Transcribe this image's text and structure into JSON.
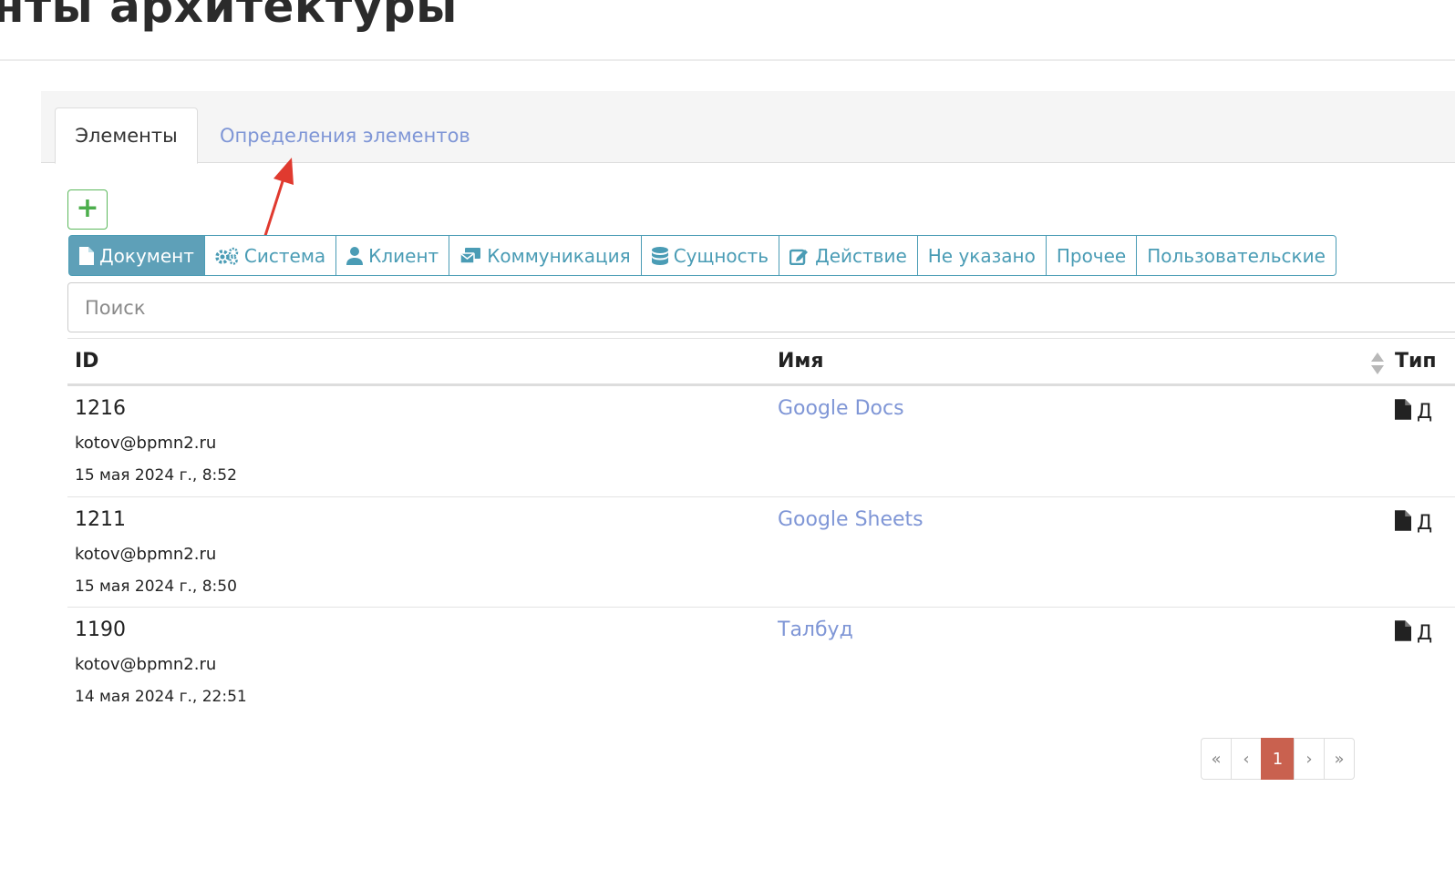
{
  "header": {
    "title": "нты архитектуры"
  },
  "tabs": [
    {
      "label": "Элементы",
      "active": true
    },
    {
      "label": "Определения элементов",
      "active": false
    }
  ],
  "toolbar": {
    "add_icon": "plus-icon"
  },
  "filters": [
    {
      "label": "Документ",
      "icon": "file-icon",
      "active": true
    },
    {
      "label": "Система",
      "icon": "gears-icon",
      "active": false
    },
    {
      "label": "Клиент",
      "icon": "user-icon",
      "active": false
    },
    {
      "label": "Коммуникация",
      "icon": "envelope-icon",
      "active": false
    },
    {
      "label": "Сущность",
      "icon": "database-icon",
      "active": false
    },
    {
      "label": "Действие",
      "icon": "edit-icon",
      "active": false
    },
    {
      "label": "Не указано",
      "icon": "",
      "active": false
    },
    {
      "label": "Прочее",
      "icon": "",
      "active": false
    },
    {
      "label": "Пользовательские",
      "icon": "",
      "active": false
    }
  ],
  "search": {
    "placeholder": "Поиск",
    "value": ""
  },
  "table": {
    "columns": [
      "ID",
      "Имя",
      "Тип"
    ],
    "rows": [
      {
        "id": "1216",
        "user": "kotov@bpmn2.ru",
        "date": "15 мая 2024 г., 8:52",
        "name": "Google Docs",
        "type": "Д"
      },
      {
        "id": "1211",
        "user": "kotov@bpmn2.ru",
        "date": "15 мая 2024 г., 8:50",
        "name": "Google Sheets",
        "type": "Д"
      },
      {
        "id": "1190",
        "user": "kotov@bpmn2.ru",
        "date": "14 мая 2024 г., 22:51",
        "name": "Талбуд",
        "type": "Д"
      }
    ]
  },
  "pagination": {
    "first": "«",
    "prev": "‹",
    "current": "1",
    "next": "›",
    "last": "»"
  },
  "colors": {
    "accent": "#5ea0b8",
    "link": "#7f96d6",
    "add": "#4cae4c",
    "pager_active": "#c9614f",
    "annotation_arrow": "#e03a2f"
  }
}
